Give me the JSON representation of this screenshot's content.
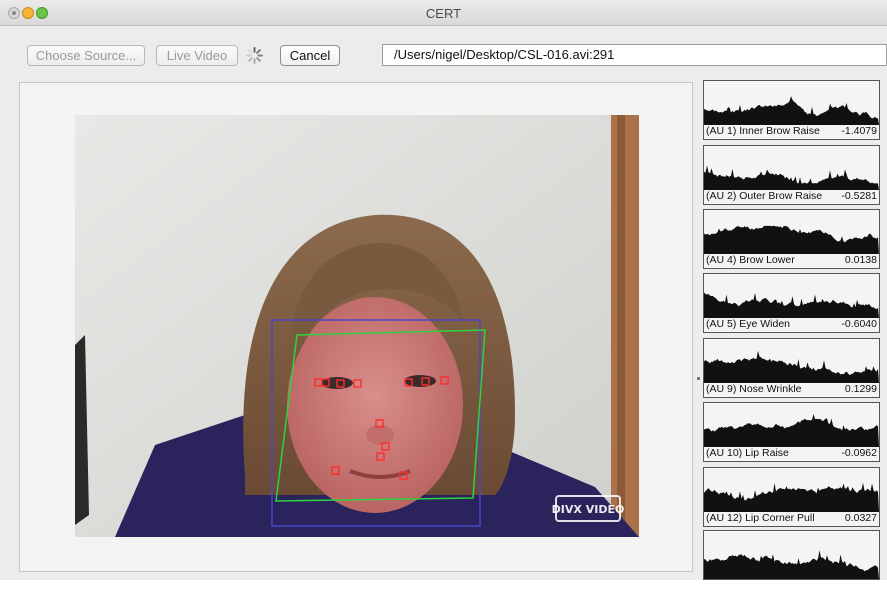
{
  "window": {
    "title": "CERT"
  },
  "toolbar": {
    "choose_source_label": "Choose Source...",
    "live_video_label": "Live Video",
    "cancel_label": "Cancel",
    "source_path": "/Users/nigel/Desktop/CSL-016.avi:291"
  },
  "video": {
    "watermark": "DIVX VIDEO"
  },
  "action_units": [
    {
      "label": "(AU 1) Inner Brow Raise",
      "value": "-1.4079"
    },
    {
      "label": "(AU 2) Outer Brow Raise",
      "value": "-0.5281"
    },
    {
      "label": "(AU 4) Brow Lower",
      "value": "0.0138"
    },
    {
      "label": "(AU 5) Eye Widen",
      "value": "-0.6040"
    },
    {
      "label": "(AU 9) Nose Wrinkle",
      "value": "0.1299"
    },
    {
      "label": "(AU 10) Lip Raise",
      "value": "-0.0962"
    },
    {
      "label": "(AU 12) Lip Corner Pull",
      "value": "0.0327"
    },
    {
      "label": "",
      "value": ""
    }
  ],
  "colors": {
    "face_box": "#4b46c8",
    "landmark_box": "#2fd23f",
    "feature_points": "#ff2d2d"
  }
}
